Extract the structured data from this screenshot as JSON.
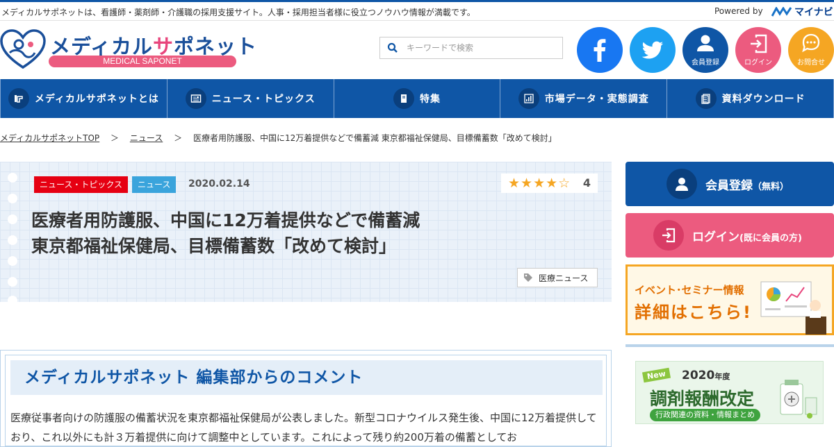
{
  "topbar": {
    "tagline": "メディカルサポネットは、看護師・薬剤師・介護職の採用支援サイト。人事・採用担当者様に役立つノウハウ情報が満載です。",
    "powered_by": "Powered by",
    "mynavi": "マイナビ"
  },
  "header": {
    "logo_part1": "メディカル",
    "logo_part2": "サ",
    "logo_part3": "ポネット",
    "logo_sub": "MEDICAL SAPONET",
    "search_placeholder": "キーワードで検索",
    "buttons": {
      "member": "会員登録",
      "login": "ログイン",
      "contact": "お問合せ"
    }
  },
  "nav": {
    "items": [
      {
        "label": "メディカルサポネットとは"
      },
      {
        "label": "ニュース・トピックス"
      },
      {
        "label": "特集"
      },
      {
        "label": "市場データ・実態調査"
      },
      {
        "label": "資料ダウンロード"
      }
    ]
  },
  "breadcrumb": {
    "home": "メディカルサポネットTOP",
    "news": "ニュース",
    "current": "医療者用防護服、中国に12万着提供などで備蓄減 東京都福祉保健局、目標備蓄数「改めて検討」",
    "separator": "＞"
  },
  "article": {
    "category1": "ニュース・トピックス",
    "category2": "ニュース",
    "date": "2020.02.14",
    "stars": "★★★★☆",
    "rating": 4,
    "title_line1": "医療者用防護服、中国に12万着提供などで備蓄減",
    "title_line2": "東京都福祉保健局、目標備蓄数「改めて検討」",
    "tag": "医療ニュース"
  },
  "comment": {
    "heading": "メディカルサポネット 編集部からのコメント",
    "body": "医療従事者向けの防護服の備蓄状況を東京都福祉保健局が公表しました。新型コロナウイルス発生後、中国に12万着提供しており、これ以外にも計３万着提供に向けて調整中としています。これによって残り約200万着の備蓄としてお"
  },
  "sidebar": {
    "member_label": "会員登録",
    "member_note": "（無料）",
    "login_label": "ログイン",
    "login_note": "(既に会員の方)",
    "event_line1": "イベント･セミナー情報",
    "event_line2": "詳細はこちら!",
    "banner_new": "New",
    "banner_year": "2020",
    "banner_year_suffix": "年度",
    "banner_main": "調剤報酬改定",
    "banner_sub": "行政関連の資料・情報まとめ"
  },
  "colors": {
    "primary": "#0f56a6",
    "pink": "#ec5b7f",
    "orange": "#f5a623",
    "red": "#e60012",
    "sky": "#3aa4dc"
  }
}
